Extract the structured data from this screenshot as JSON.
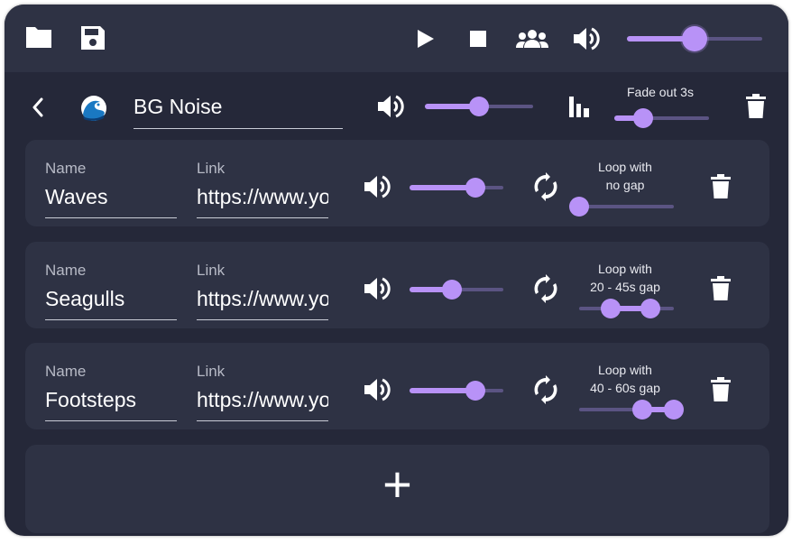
{
  "toolbar": {
    "icons": [
      "folder-icon",
      "save-icon",
      "play-icon",
      "stop-icon",
      "group-icon",
      "volume-icon"
    ],
    "master_volume": 0.5
  },
  "scene": {
    "title": "BG Noise",
    "volume": 0.5,
    "fade_label": "Fade out 3s",
    "fade_value": 0.3
  },
  "labels": {
    "name": "Name",
    "link": "Link"
  },
  "sounds": [
    {
      "name": "Waves",
      "link": "https://www.youtube.com",
      "volume": 0.7,
      "loop_line1": "Loop with",
      "loop_line2": "no gap",
      "gap": [
        0,
        0
      ]
    },
    {
      "name": "Seagulls",
      "link": "https://www.youtube.com",
      "volume": 0.45,
      "loop_line1": "Loop with",
      "loop_line2": "20 - 45s gap",
      "gap": [
        20,
        45
      ]
    },
    {
      "name": "Footsteps",
      "link": "https://www.youtube.com",
      "volume": 0.7,
      "loop_line1": "Loop with",
      "loop_line2": "40 - 60s gap",
      "gap": [
        40,
        60
      ]
    }
  ],
  "gap_max": 60,
  "add_label": "+",
  "colors": {
    "accent": "#b892f7",
    "background": "#252839",
    "panel": "#2e3244"
  }
}
